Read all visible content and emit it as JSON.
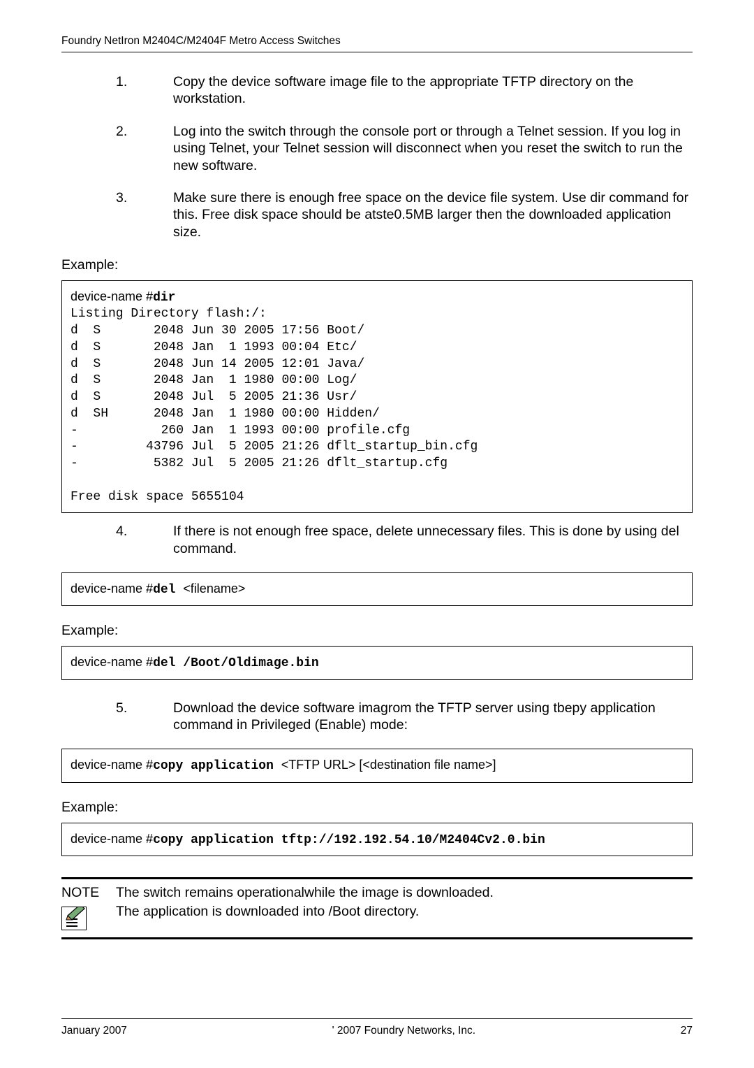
{
  "header": {
    "title": "Foundry NetIron M2404C/M2404F Metro Access Switches"
  },
  "steps": [
    {
      "num": "1.",
      "text": "Copy the device software image file to the appropriate TFTP directory on the workstation."
    },
    {
      "num": "2.",
      "text": "Log into the switch through the console port or through a Telnet session. If you log in using Telnet, your Telnet session will disconnect when you reset the switch to run the new software."
    },
    {
      "num": "3.",
      "text": "Make sure there is enough free space on the device file system. Use  dir  command for this. Free disk space should be atste0.5MB larger then the downloaded application size."
    }
  ],
  "example_label": "Example:",
  "dir_prompt": "device-name  #",
  "dir_cmd": "dir",
  "dir_output": "Listing Directory flash:/:\nd  S       2048 Jun 30 2005 17:56 Boot/\nd  S       2048 Jan  1 1993 00:04 Etc/\nd  S       2048 Jun 14 2005 12:01 Java/\nd  S       2048 Jan  1 1980 00:00 Log/\nd  S       2048 Jul  5 2005 21:36 Usr/\nd  SH      2048 Jan  1 1980 00:00 Hidden/\n-           260 Jan  1 1993 00:00 profile.cfg\n-         43796 Jul  5 2005 21:26 dflt_startup_bin.cfg\n-          5382 Jul  5 2005 21:26 dflt_startup.cfg\n\nFree disk space 5655104",
  "step4": {
    "num": "4.",
    "text": "If there is not enough free space, delete unnecessary files. This is done by using  del command."
  },
  "del_syntax": {
    "prompt": "device-name  #",
    "cmd": "del ",
    "arg": "<filename>"
  },
  "del_example": {
    "prompt": "device-name  #",
    "cmd": "del /Boot/Oldimage.bin"
  },
  "step5": {
    "num": "5.",
    "text": "Download the device software imagrom the TFTP server using tbepy application command in Privileged (Enable) mode:"
  },
  "copy_syntax": {
    "prompt": "device-name  #",
    "cmd": "copy application ",
    "arg": "<TFTP URL> [<destination file name>]"
  },
  "copy_example": {
    "prompt": "device-name  #",
    "cmd": "copy application tftp://192.192.54.10/M2404Cv2.0.bin"
  },
  "note": {
    "tag": "NOTE",
    "line1": "The switch remains operationalwhile the image is downloaded.",
    "line2": "The application is downloaded into /Boot directory."
  },
  "footer": {
    "left": "January 2007",
    "center": "' 2007 Foundry Networks, Inc.",
    "right": "27"
  }
}
